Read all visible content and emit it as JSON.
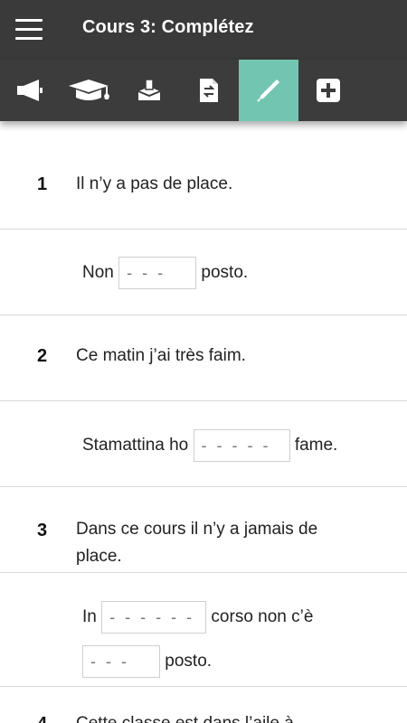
{
  "app": {
    "title": "Cours 3: Complétez"
  },
  "toolbar": {
    "active_color": "#72c6b1",
    "items": [
      {
        "icon": "megaphone-icon"
      },
      {
        "icon": "graduation-cap-icon"
      },
      {
        "icon": "ballot-box-icon"
      },
      {
        "icon": "document-swap-icon"
      },
      {
        "icon": "pencil-icon",
        "active": true
      },
      {
        "icon": "plus-icon"
      }
    ]
  },
  "exercises": [
    {
      "number": "1",
      "prompt": "Il n’y a pas de place.",
      "answer": {
        "before": "Non",
        "blank1_placeholder": "- - -",
        "after": "posto."
      }
    },
    {
      "number": "2",
      "prompt": "Ce matin j’ai très faim.",
      "answer": {
        "before": "Stamattina ho",
        "blank1_placeholder": "- - - - -",
        "after": "fame."
      }
    },
    {
      "number": "3",
      "prompt_line1": "Dans ce cours il n’y a jamais de",
      "prompt_line2": "place.",
      "answer": {
        "before": "In",
        "blank1_placeholder": "- - - - - -",
        "middle": "corso non c’è",
        "blank2_placeholder": "- - -",
        "after": "posto."
      }
    },
    {
      "number": "4",
      "prompt_partial": "Cette classe est dans l’aile à"
    }
  ]
}
